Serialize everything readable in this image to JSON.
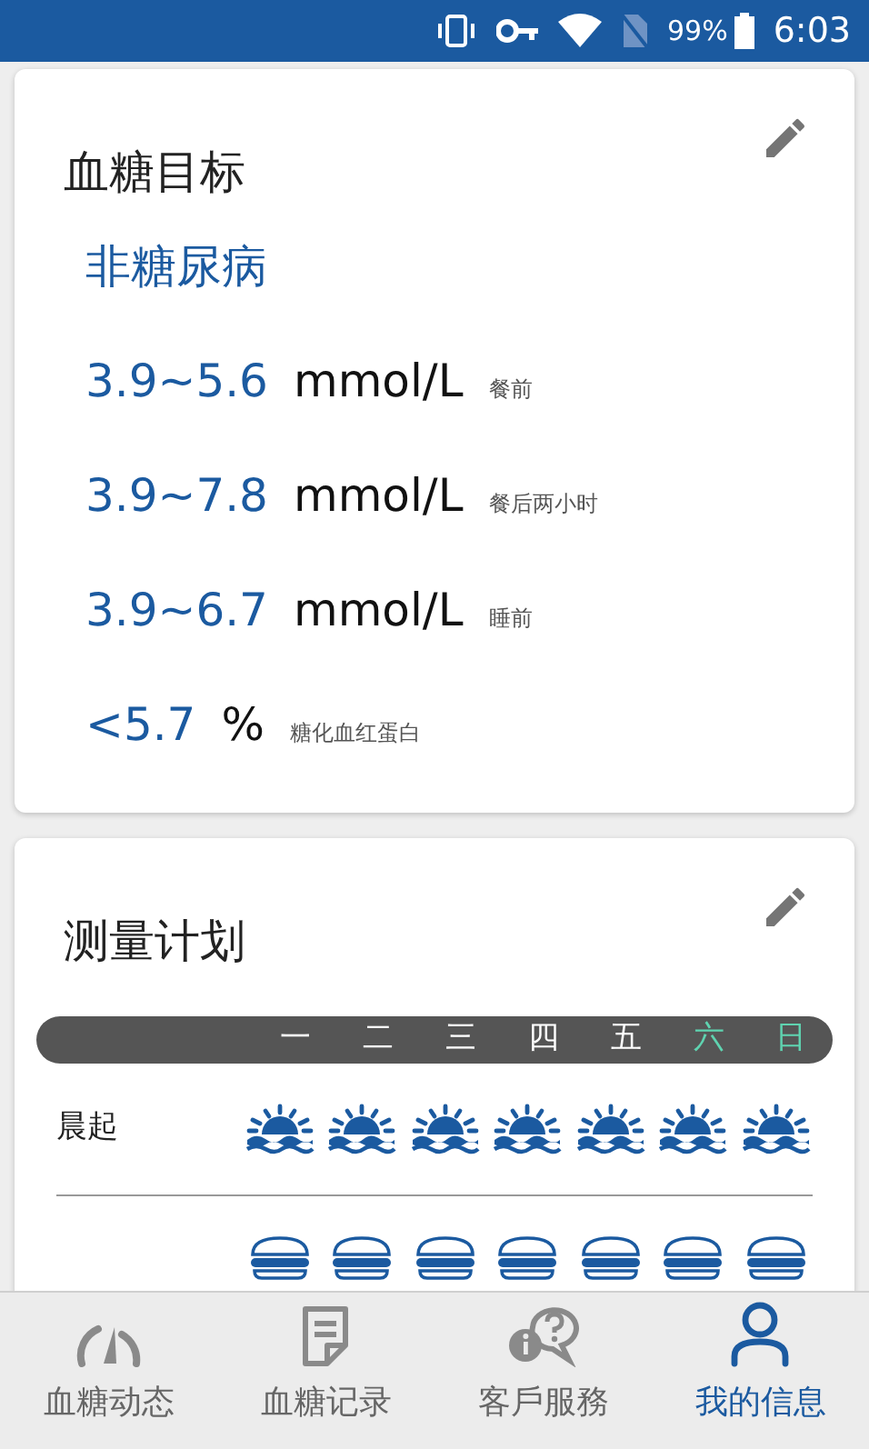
{
  "status_bar": {
    "battery": "99%",
    "time": "6:03"
  },
  "target_card": {
    "title": "血糖目标",
    "category": "非糖尿病",
    "targets": [
      {
        "value": "3.9~5.6",
        "unit": "mmol/L",
        "note": "餐前"
      },
      {
        "value": "3.9~7.8",
        "unit": "mmol/L",
        "note": "餐后两小时"
      },
      {
        "value": "3.9~6.7",
        "unit": "mmol/L",
        "note": "睡前"
      },
      {
        "value": "<5.7",
        "unit": "%",
        "note": "糖化血红蛋白"
      }
    ]
  },
  "plan_card": {
    "title": "测量计划",
    "days": [
      {
        "label": "一",
        "weekend": false
      },
      {
        "label": "二",
        "weekend": false
      },
      {
        "label": "三",
        "weekend": false
      },
      {
        "label": "四",
        "weekend": false
      },
      {
        "label": "五",
        "weekend": false
      },
      {
        "label": "六",
        "weekend": true
      },
      {
        "label": "日",
        "weekend": true
      }
    ],
    "rows": [
      {
        "label": "晨起",
        "kind": "sunrise",
        "days": [
          true,
          true,
          true,
          true,
          true,
          true,
          true
        ]
      },
      {
        "kind": "meal",
        "days": [
          true,
          true,
          true,
          true,
          true,
          true,
          true
        ]
      }
    ]
  },
  "tab_bar": [
    {
      "label": "血糖动态",
      "kind": "gauge",
      "selected": false
    },
    {
      "label": "血糖记录",
      "kind": "note",
      "selected": false
    },
    {
      "label": "客戶服務",
      "kind": "chat",
      "selected": false
    },
    {
      "label": "我的信息",
      "kind": "person",
      "selected": true
    }
  ]
}
